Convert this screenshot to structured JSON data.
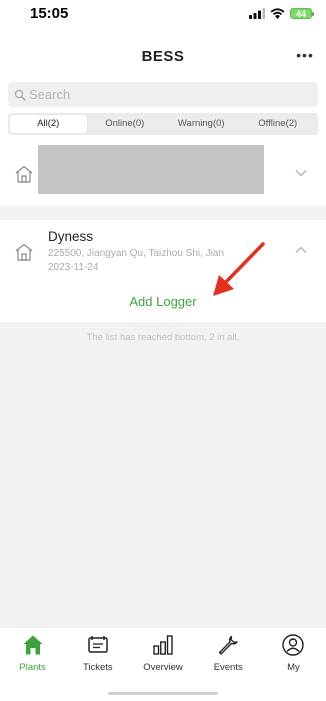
{
  "status_bar": {
    "time": "15:05",
    "battery": "44"
  },
  "header": {
    "title": "BESS",
    "more": "•••"
  },
  "search": {
    "placeholder": "Search"
  },
  "filters": [
    {
      "label": "All(2)",
      "active": true
    },
    {
      "label": "Online(0)",
      "active": false
    },
    {
      "label": "Warning(0)",
      "active": false
    },
    {
      "label": "Offline(2)",
      "active": false
    }
  ],
  "plants": [
    {
      "name": "",
      "address": "",
      "date": "",
      "expanded": false
    },
    {
      "name": "Dyness",
      "address": "225500, Jiangyan Qu, Taizhou Shi, Jian",
      "date": "2023-11-24",
      "expanded": true,
      "action": "Add Logger"
    }
  ],
  "list_end": "The list has reached bottom, 2 in all.",
  "tabs": [
    {
      "label": "Plants",
      "icon": "home-icon",
      "active": true
    },
    {
      "label": "Tickets",
      "icon": "ticket-icon",
      "active": false
    },
    {
      "label": "Overview",
      "icon": "overview-icon",
      "active": false
    },
    {
      "label": "Events",
      "icon": "wrench-icon",
      "active": false
    },
    {
      "label": "My",
      "icon": "user-icon",
      "active": false
    }
  ],
  "colors": {
    "accent": "#3fa13f",
    "annotation": "#e0301e"
  }
}
